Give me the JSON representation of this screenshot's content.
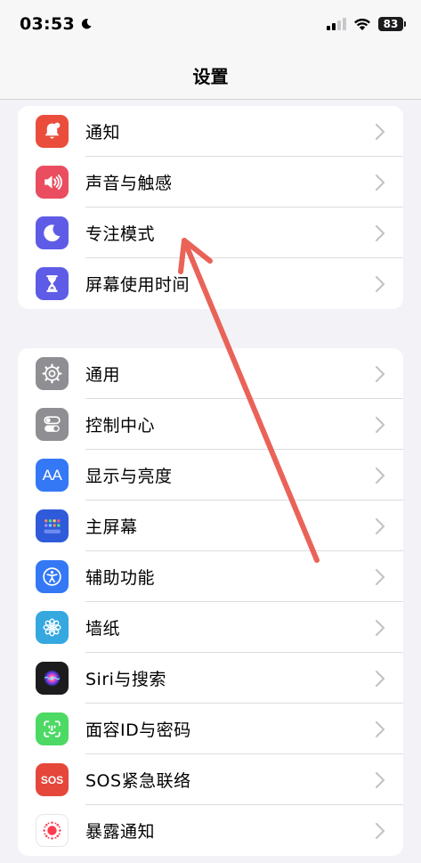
{
  "status_bar": {
    "time": "03:53",
    "battery": "83"
  },
  "nav": {
    "title": "设置"
  },
  "groups": [
    {
      "items": [
        {
          "label": "通知",
          "icon": "bell-icon",
          "color": "#eb4d3d"
        },
        {
          "label": "声音与触感",
          "icon": "speaker-icon",
          "color": "#ea4d5f"
        },
        {
          "label": "专注模式",
          "icon": "moon-icon",
          "color": "#5e5ce6"
        },
        {
          "label": "屏幕使用时间",
          "icon": "hourglass-icon",
          "color": "#5e5ce6"
        }
      ]
    },
    {
      "items": [
        {
          "label": "通用",
          "icon": "gear-icon",
          "color": "#8e8e93"
        },
        {
          "label": "控制中心",
          "icon": "toggle-icon",
          "color": "#8e8e93"
        },
        {
          "label": "显示与亮度",
          "icon": "text-size-icon",
          "color": "#3478f6"
        },
        {
          "label": "主屏幕",
          "icon": "home-grid-icon",
          "color": "#2f5bdb"
        },
        {
          "label": "辅助功能",
          "icon": "accessibility-icon",
          "color": "#3478f6"
        },
        {
          "label": "墙纸",
          "icon": "flower-icon",
          "color": "#36a8e0"
        },
        {
          "label": "Siri与搜索",
          "icon": "siri-icon",
          "color": "#1c1c1e"
        },
        {
          "label": "面容ID与密码",
          "icon": "face-id-icon",
          "color": "#4cd964"
        },
        {
          "label": "SOS紧急联络",
          "icon": "sos-icon",
          "color": "#e5473b"
        },
        {
          "label": "暴露通知",
          "icon": "exposure-icon",
          "color": "#ffffff"
        }
      ]
    }
  ],
  "sos_text": "SOS",
  "text_size_text": "AA"
}
